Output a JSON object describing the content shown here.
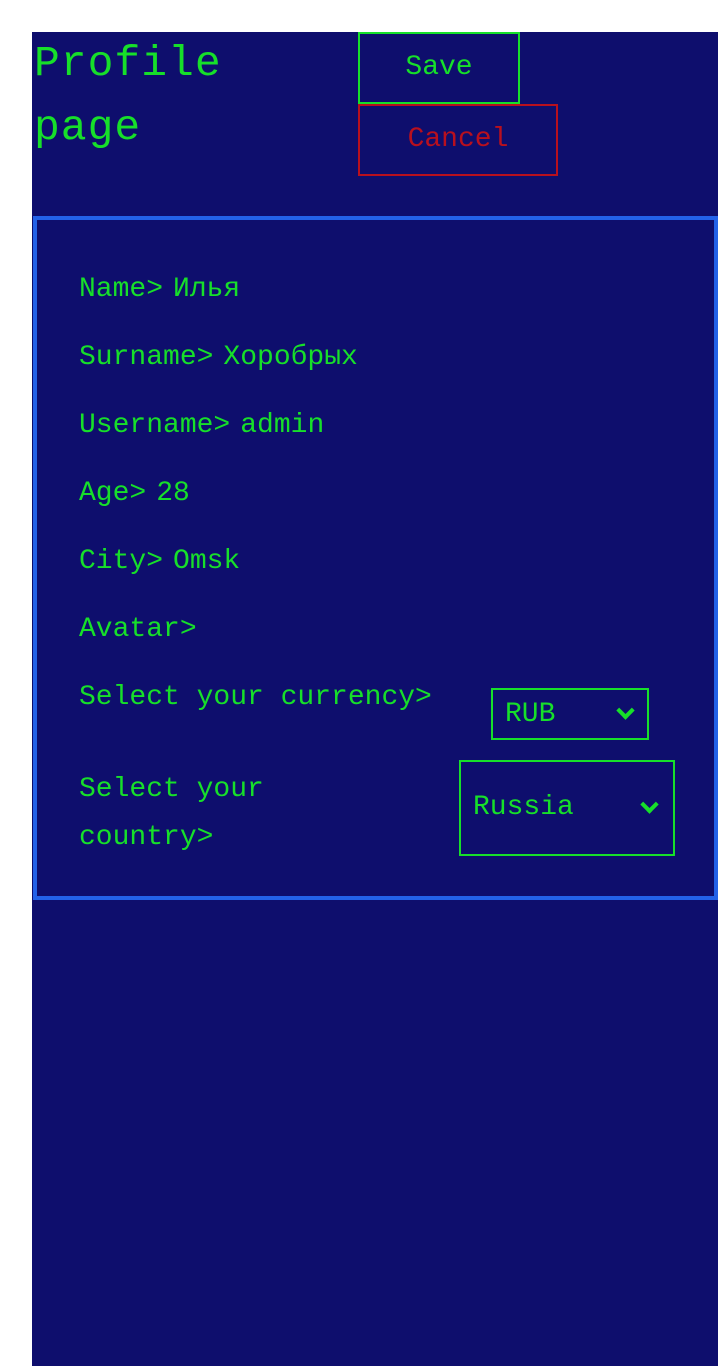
{
  "header": {
    "title": "Profile\npage",
    "save_label": "Save",
    "cancel_label": "Cancel"
  },
  "profile": {
    "name_label": "Name>",
    "name_value": "Илья",
    "surname_label": "Surname>",
    "surname_value": "Хоробрых",
    "username_label": "Username>",
    "username_value": "admin",
    "age_label": "Age>",
    "age_value": "28",
    "city_label": "City>",
    "city_value": "Omsk",
    "avatar_label": "Avatar>",
    "currency_label": "Select your currency>",
    "currency_value": "RUB",
    "country_label": "Select your\ncountry>",
    "country_value": "Russia"
  },
  "colors": {
    "background": "#0e0e6d",
    "text": "#17df2a",
    "cancel": "#b8101e",
    "border": "#2362e8"
  }
}
